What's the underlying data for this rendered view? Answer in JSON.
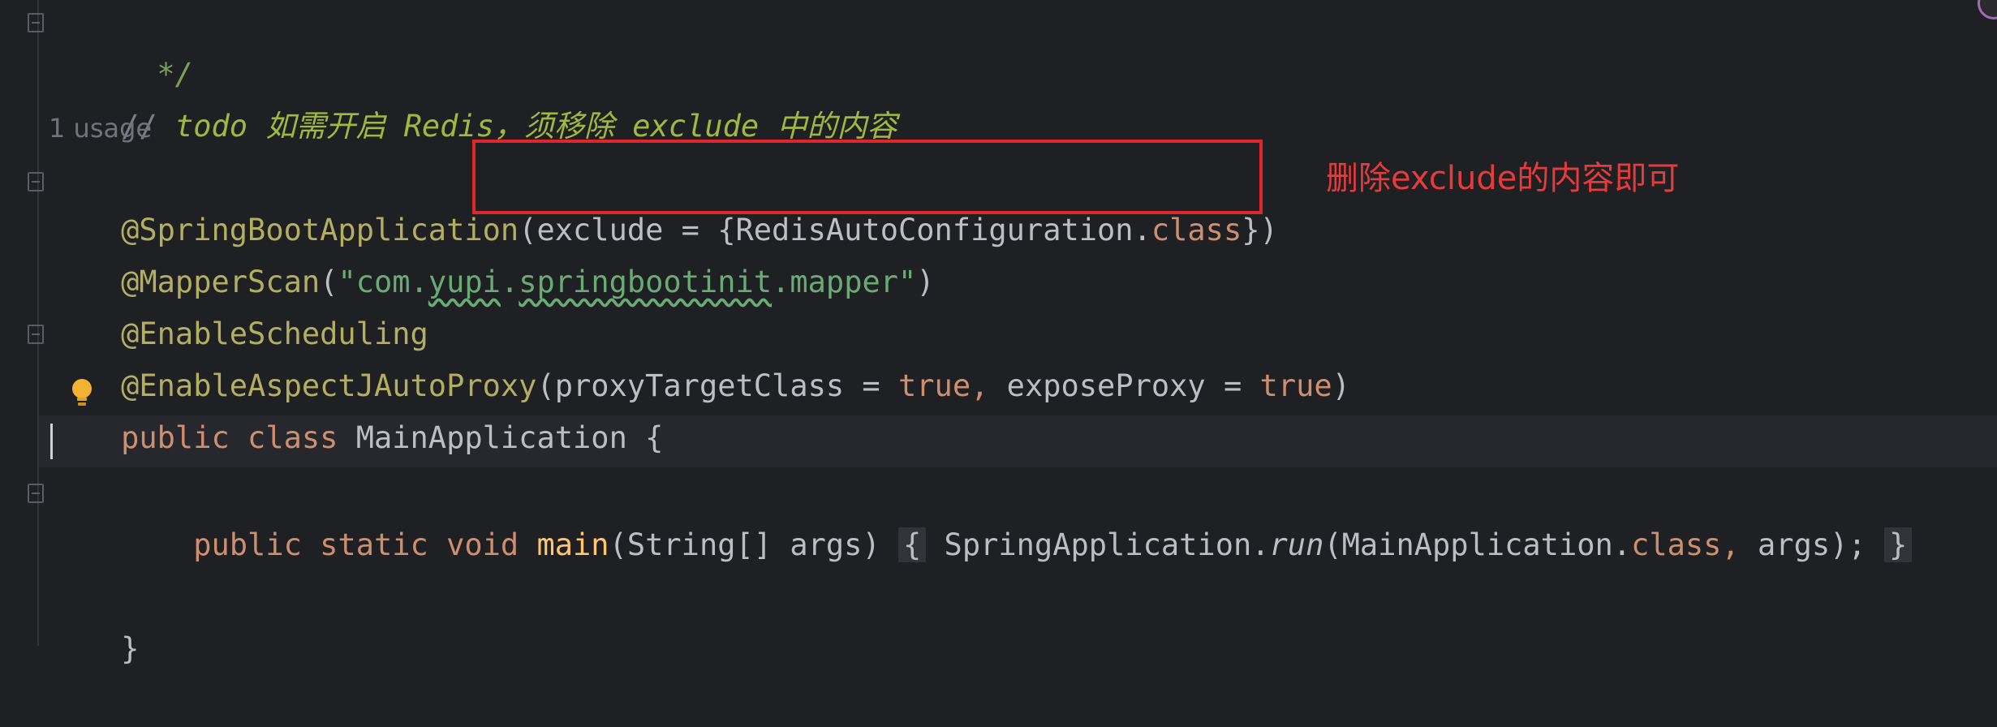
{
  "editor": {
    "line_comment_end": " */",
    "todo_comment": {
      "prefix": "// ",
      "text": "todo 如需开启 Redis，须移除 exclude 中的内容"
    },
    "usage_hint": "1 usage",
    "lines": {
      "l1_annotation": "@SpringBootApplication",
      "l1_args_open": "(exclude = {RedisAutoConfiguration.",
      "l1_class_kw": "class",
      "l1_args_close": "})",
      "l2_annotation": "@MapperScan",
      "l2_paren_open": "(",
      "l2_str_q1": "\"com.",
      "l2_str_yupi": "yupi",
      "l2_str_dot": ".",
      "l2_str_sbi": "springbootinit",
      "l2_str_rest": ".mapper\"",
      "l2_paren_close": ")",
      "l3_annotation": "@EnableScheduling",
      "l4_annotation": "@EnableAspectJAutoProxy",
      "l4_p1": "(proxyTargetClass = ",
      "l4_true1": "true",
      "l4_comma": ", ",
      "l4_p2": "exposeProxy = ",
      "l4_true2": "true",
      "l4_close": ")",
      "l5_kw": "public class ",
      "l5_name": "MainApplication {",
      "l7_indent": "    ",
      "l7_kw": "public static void ",
      "l7_method": "main",
      "l7_sig": "(String[] args)",
      "l7_brace_open": "{",
      "l7_call": " SpringApplication.",
      "l7_run": "run",
      "l7_args": "(MainApplication.",
      "l7_class": "class",
      "l7_comma": ", ",
      "l7_args2": "args);",
      "l7_brace_close": "}",
      "l9_close": "}"
    }
  },
  "annotation": {
    "note": "删除exclude的内容即可",
    "box_color": "#e0262b"
  }
}
